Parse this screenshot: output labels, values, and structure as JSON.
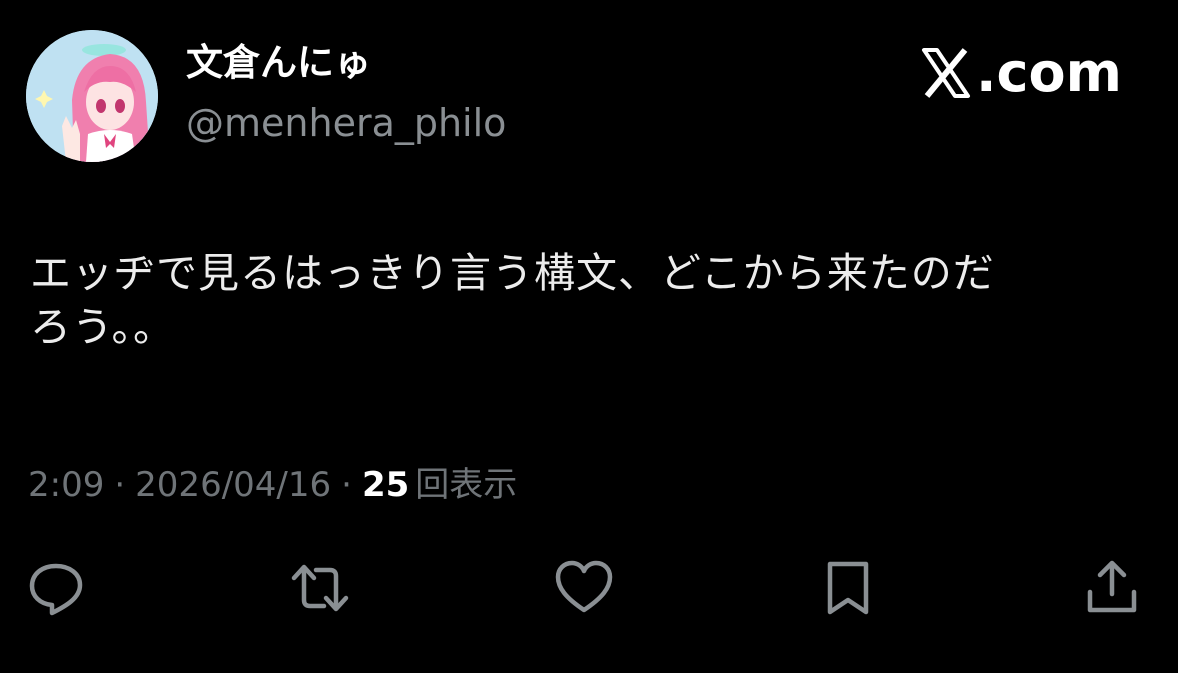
{
  "author": {
    "display_name": "文倉んにゅ",
    "handle": "@menhera_philo"
  },
  "brand": {
    "domain_suffix": ".com",
    "icon": "x-logo-icon"
  },
  "tweet": {
    "text_lines": [
      "エッヂで見るはっきり言う構文、どこから来たのだ",
      "ろう。。"
    ]
  },
  "meta": {
    "time": "2:09",
    "separator": "·",
    "date": "2026/04/16",
    "views_count": "25",
    "views_label": "回表示"
  },
  "actions": [
    {
      "name": "reply",
      "icon": "reply-icon"
    },
    {
      "name": "repost",
      "icon": "repost-icon"
    },
    {
      "name": "like",
      "icon": "heart-icon"
    },
    {
      "name": "bookmark",
      "icon": "bookmark-icon"
    },
    {
      "name": "share",
      "icon": "share-icon"
    }
  ],
  "colors": {
    "background": "#000000",
    "primary_text": "#ffffff",
    "secondary_text": "#8a8f93",
    "icon": "#8a8f93",
    "avatar_bg": "#bfe1f2",
    "avatar_hair": "#f07fae"
  }
}
